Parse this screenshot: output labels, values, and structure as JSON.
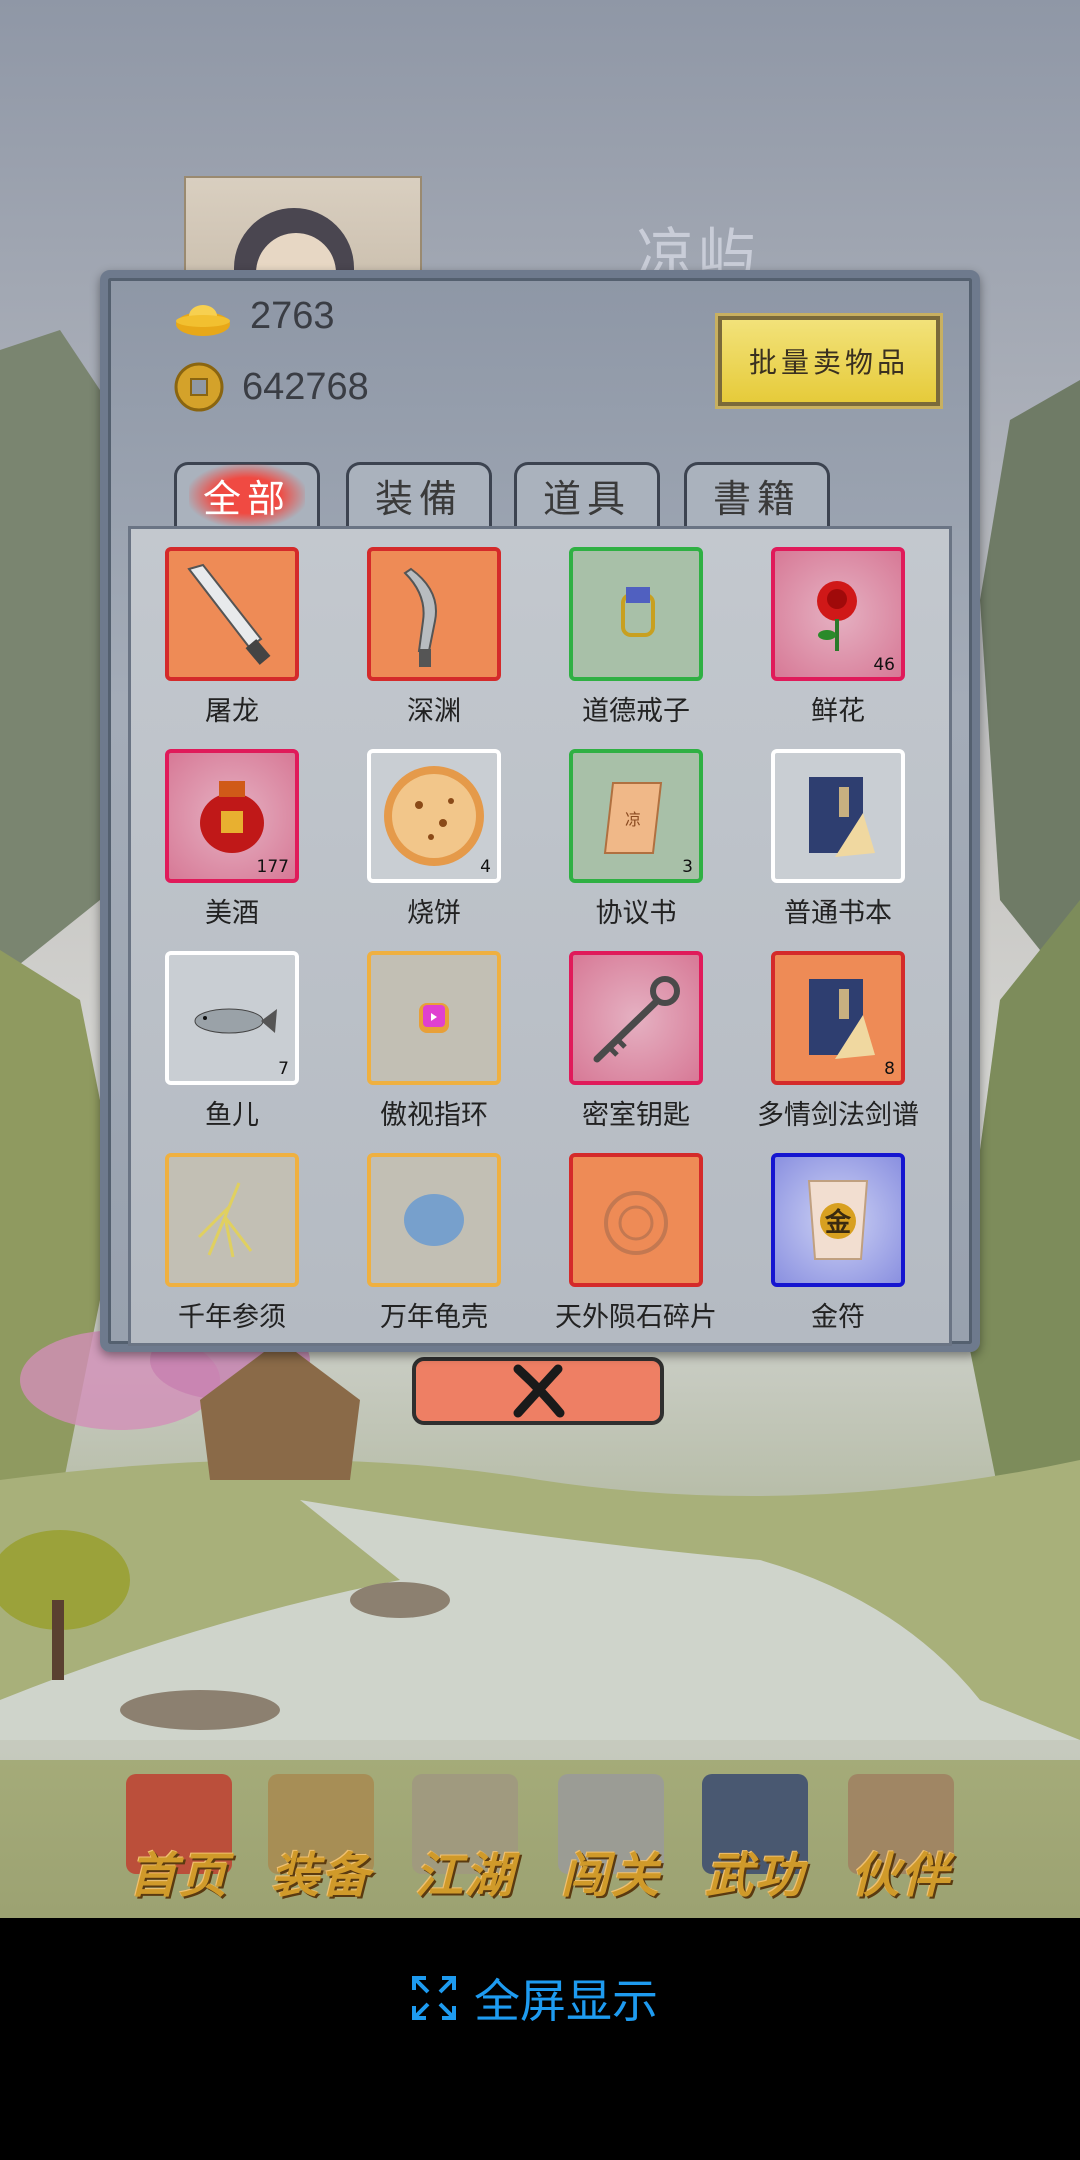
{
  "scene": {
    "location_name": "凉屿"
  },
  "currency": {
    "gold_ingot": "2763",
    "copper_coin": "642768"
  },
  "panel": {
    "sell_button_label": "批量卖物品"
  },
  "tabs": [
    {
      "label": "全部",
      "active": true
    },
    {
      "label": "装備",
      "active": false
    },
    {
      "label": "道具",
      "active": false
    },
    {
      "label": "書籍",
      "active": false
    }
  ],
  "items": [
    {
      "name": "屠龙",
      "qty": "",
      "icon": "broadsword-icon"
    },
    {
      "name": "深渊",
      "qty": "",
      "icon": "curved-blade-icon"
    },
    {
      "name": "道德戒子",
      "qty": "",
      "icon": "ring-icon"
    },
    {
      "name": "鲜花",
      "qty": "46",
      "icon": "rose-icon"
    },
    {
      "name": "美酒",
      "qty": "177",
      "icon": "wine-jar-icon"
    },
    {
      "name": "烧饼",
      "qty": "4",
      "icon": "flatbread-icon"
    },
    {
      "name": "协议书",
      "qty": "3",
      "icon": "scroll-paper-icon"
    },
    {
      "name": "普通书本",
      "qty": "",
      "icon": "book-icon"
    },
    {
      "name": "鱼儿",
      "qty": "7",
      "icon": "fish-icon"
    },
    {
      "name": "傲视指环",
      "qty": "",
      "icon": "gem-ring-icon"
    },
    {
      "name": "密室钥匙",
      "qty": "",
      "icon": "key-icon"
    },
    {
      "name": "多情剑法剑谱",
      "qty": "8",
      "icon": "manual-book-icon"
    },
    {
      "name": "千年参须",
      "qty": "",
      "icon": "ginseng-icon"
    },
    {
      "name": "万年龟壳",
      "qty": "",
      "icon": "turtle-shell-icon"
    },
    {
      "name": "天外陨石碎片",
      "qty": "",
      "icon": "meteorite-icon"
    },
    {
      "name": "金符",
      "qty": "",
      "icon": "gold-talisman-icon"
    }
  ],
  "talisman_char": "金",
  "scroll_char": "凉",
  "bottom_nav": [
    {
      "label": "首页",
      "icon": "house-icon"
    },
    {
      "label": "装备",
      "icon": "armor-icon"
    },
    {
      "label": "江湖",
      "icon": "scroll-map-icon"
    },
    {
      "label": "闯关",
      "icon": "crossed-swords-icon"
    },
    {
      "label": "武功",
      "icon": "martial-book-icon"
    },
    {
      "label": "伙伴",
      "icon": "companions-icon"
    }
  ],
  "footer": {
    "fullscreen_label": "全屏显示"
  },
  "colors": {
    "fullscreen_blue": "#1e9bf0",
    "close_button": "#ee7f64",
    "sell_button": "#e6cb3a"
  }
}
